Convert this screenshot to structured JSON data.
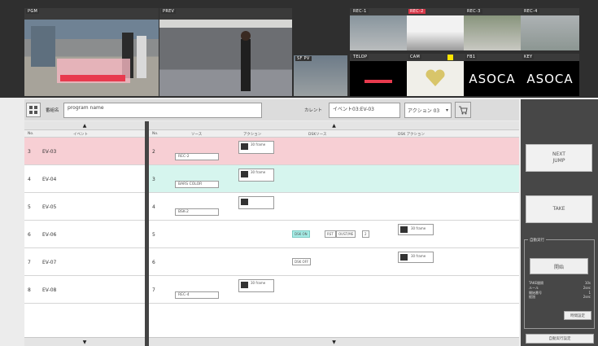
{
  "monitors": {
    "pgm_label": "PGM",
    "prev_label": "PREV",
    "sfpv_label": "SF PV",
    "rec_labels": [
      "REC-1",
      "REC-2",
      "REC-3",
      "REC-4"
    ],
    "telop_label": "TELOP",
    "cam_label": "CAM",
    "fb1_label": "FB1",
    "key_label": "KEY",
    "logo_text": "ASOCA",
    "active_tally_color": "#d9384a"
  },
  "control_bar": {
    "program_label": "番組名",
    "program_value": "program name",
    "current_label": "カレント",
    "current_value": "イベント03:EV-03",
    "action_select": "アクション 03"
  },
  "left_list": {
    "col_no": "No.",
    "col_event": "イベント",
    "rows": [
      {
        "no": "3",
        "event": "EV-03"
      },
      {
        "no": "4",
        "event": "EV-04"
      },
      {
        "no": "5",
        "event": "EV-05"
      },
      {
        "no": "6",
        "event": "EV-06"
      },
      {
        "no": "7",
        "event": "EV-07"
      },
      {
        "no": "8",
        "event": "EV-08"
      }
    ]
  },
  "right_list": {
    "col_no": "No.",
    "col_source": "ソース",
    "col_action": "アクション",
    "col_dsk_source": "DSKソース",
    "col_dsk_action": "DSK アクション",
    "rows": [
      {
        "no": "2",
        "source": "REC-2",
        "action": "30 frame"
      },
      {
        "no": "3",
        "source": "BARS COLOR",
        "action": "30 frame"
      },
      {
        "no": "4",
        "source": "BSK-2",
        "action": ""
      },
      {
        "no": "5",
        "source": "",
        "action": "",
        "dsk_a": "DSK ON",
        "dsk_b": "RST",
        "dsk_c": "OUST/ME",
        "dsk_d": "2",
        "dsk_action": "30 frame"
      },
      {
        "no": "6",
        "source": "",
        "action": "",
        "dsk_a": "DSK OFF",
        "dsk_action": "30 frame"
      },
      {
        "no": "7",
        "source": "REC-4",
        "action": "30 frame"
      }
    ]
  },
  "right_panel": {
    "next_jump": "NEXT\nJUMP",
    "take": "TAKE",
    "ae_title": "自動実行",
    "ae_button": "開始",
    "ae_rows": [
      {
        "k": "TAKE間隔",
        "v": "10s"
      },
      {
        "k": "ルール",
        "v": "2sec"
      },
      {
        "k": "開始番号",
        "v": "1"
      },
      {
        "k": "経過",
        "v": "2sec"
      }
    ],
    "ae_settime": "時間設定",
    "ae_reset": "自動実行設定"
  }
}
